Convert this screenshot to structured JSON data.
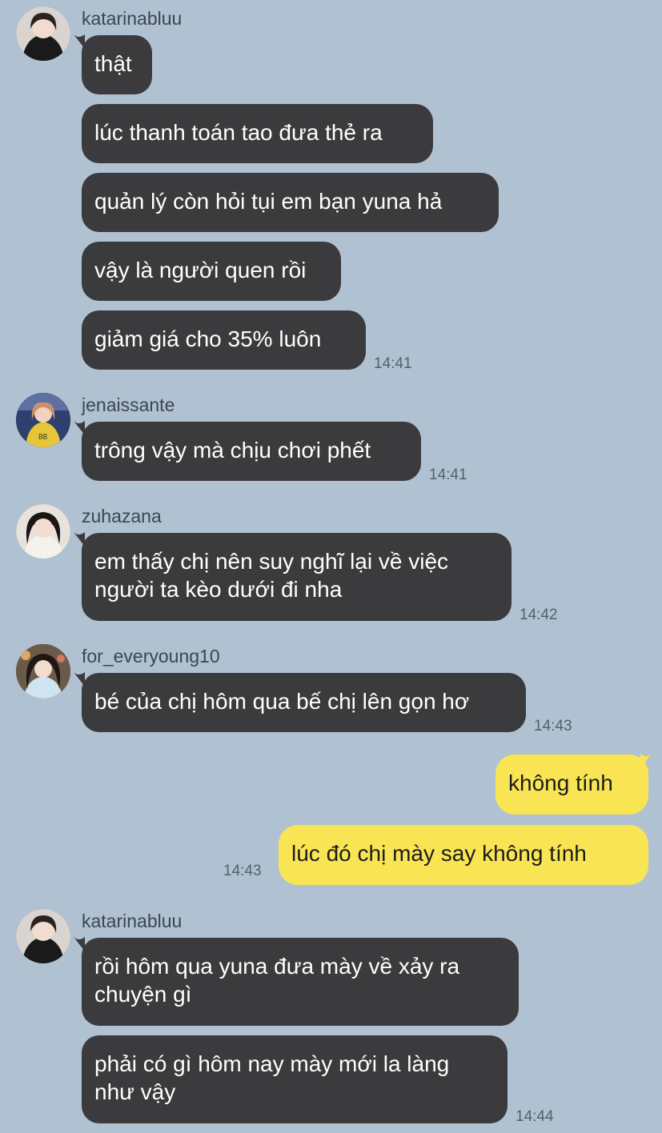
{
  "messages": {
    "g1": {
      "sender": "katarinabluu",
      "lines": [
        "thật",
        "lúc thanh toán tao đưa thẻ ra",
        "quản lý còn hỏi tụi em bạn yuna hả",
        "vậy là người quen rồi",
        "giảm giá cho 35% luôn"
      ],
      "time": "14:41"
    },
    "g2": {
      "sender": "jenaissante",
      "lines": [
        "trông vậy mà chịu chơi phết"
      ],
      "time": "14:41"
    },
    "g3": {
      "sender": "zuhazana",
      "lines": [
        "em thấy chị nên suy nghĩ lại về việc",
        "người ta kèo dưới đi nha"
      ],
      "time": "14:42"
    },
    "g4": {
      "sender": "for_everyoung10",
      "lines": [
        "bé của chị hôm qua bế chị lên gọn hơ"
      ],
      "time": "14:43"
    },
    "mine": {
      "lines": [
        "không tính",
        "lúc đó chị mày say không tính"
      ],
      "time": "14:43"
    },
    "g5": {
      "sender": "katarinabluu",
      "lines": [
        "rồi hôm qua yuna đưa mày về xảy ra",
        "chuyện gì",
        "phải có gì hôm nay mày mới la làng",
        "như vậy"
      ],
      "time": "14:44"
    }
  },
  "colors": {
    "background": "#b0c1d2",
    "incoming_bubble": "#3b3a3d",
    "outgoing_bubble": "#f9e554"
  },
  "icons": [
    "avatar-katarinabluu",
    "avatar-jenaissante",
    "avatar-zuhazana",
    "avatar-for_everyoung10"
  ]
}
